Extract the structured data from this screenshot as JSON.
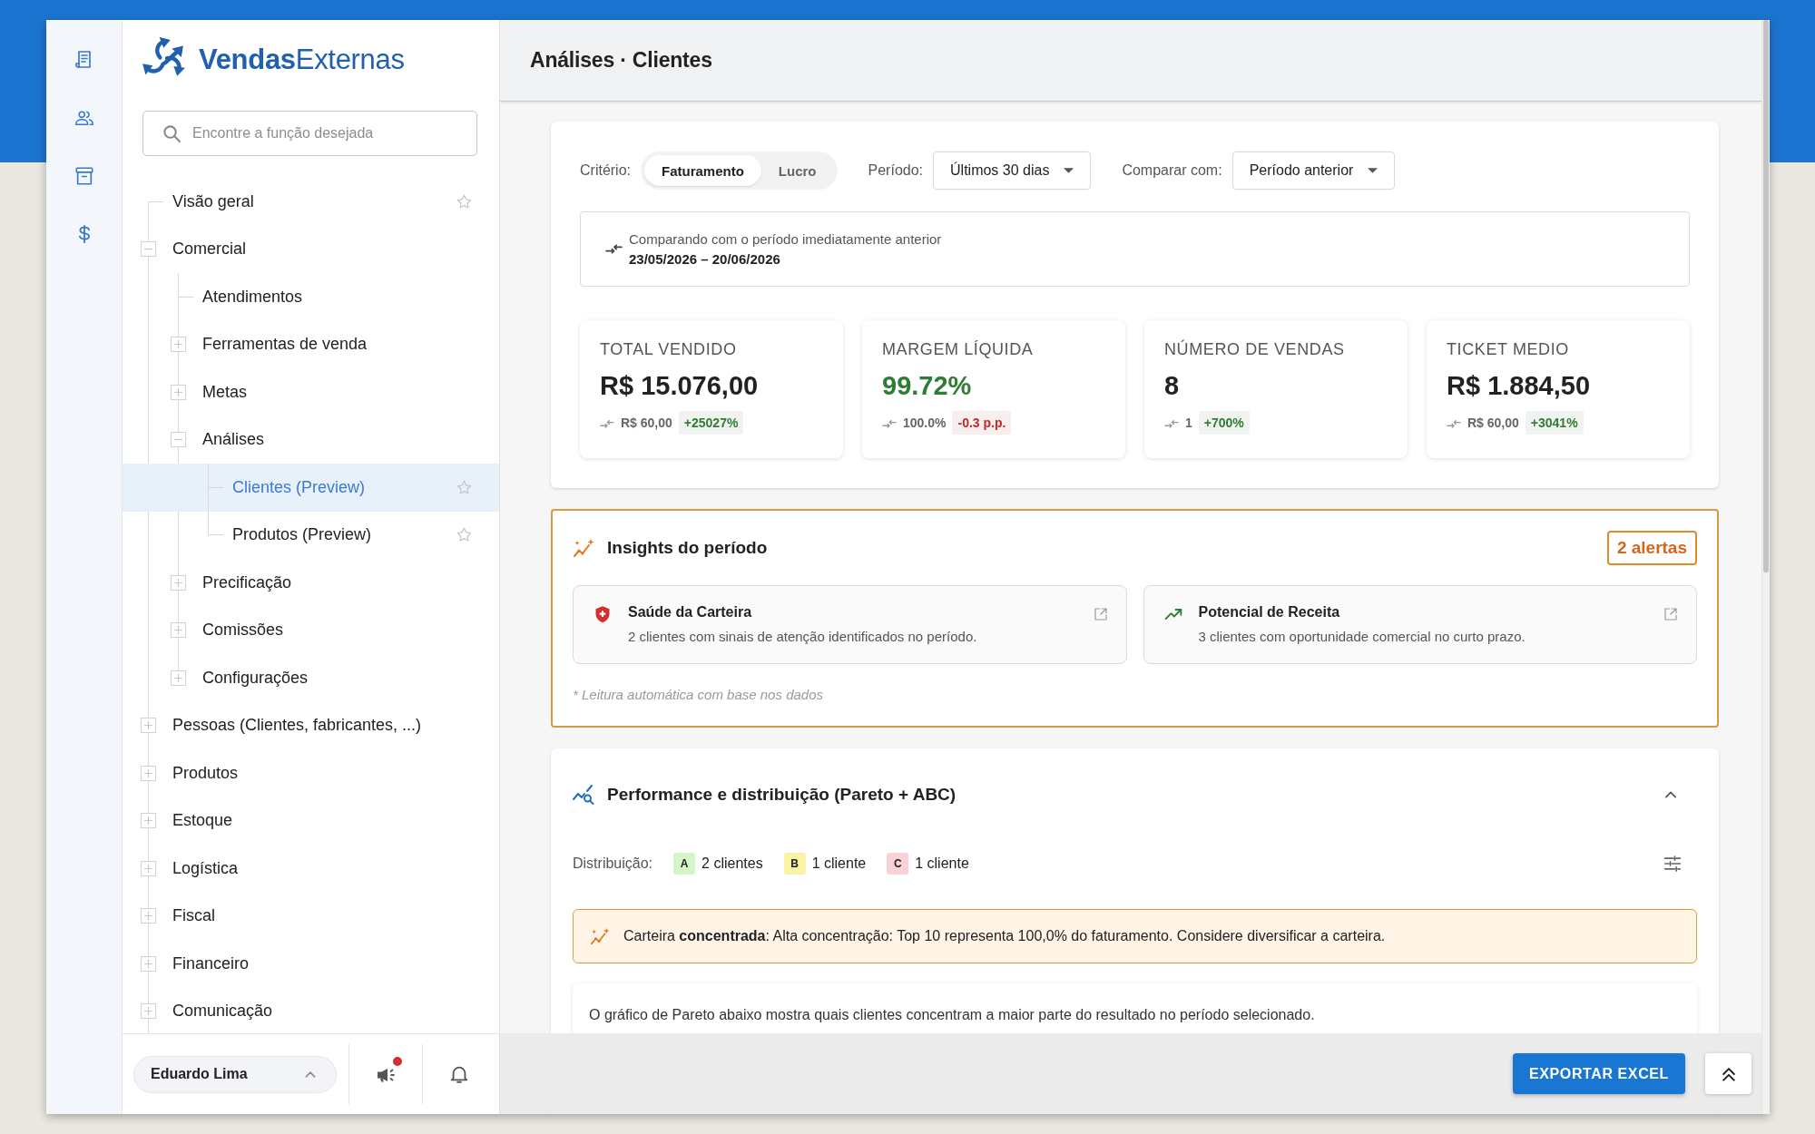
{
  "sidebar": {
    "logo": "**Vendas**Externas",
    "search": {
      "placeholder": "Encontre a função desejada"
    },
    "tree": [
      {
        "label": "Visão geral",
        "kind": "page",
        "selected": false,
        "favorite": false
      },
      {
        "label": "Comercial",
        "kind": "group",
        "expanded": true,
        "selected": false,
        "children": [
          {
            "label": "Atendimentos",
            "kind": "page",
            "selected": false
          },
          {
            "label": "Ferramentas de venda",
            "kind": "group",
            "expanded": false,
            "selected": false
          },
          {
            "label": "Metas",
            "kind": "group",
            "expanded": false,
            "selected": false
          },
          {
            "label": "Análises",
            "kind": "group",
            "expanded": true,
            "selected": false,
            "children": [
              {
                "label": "Clientes (Preview)",
                "kind": "page",
                "selected": true,
                "favorite": false
              },
              {
                "label": "Produtos (Preview)",
                "kind": "page",
                "selected": false,
                "favorite": false
              }
            ]
          },
          {
            "label": "Precificação",
            "kind": "group",
            "expanded": false,
            "selected": false
          },
          {
            "label": "Comissões",
            "kind": "group",
            "expanded": false,
            "selected": false
          },
          {
            "label": "Configurações",
            "kind": "group",
            "expanded": false,
            "selected": false
          }
        ]
      },
      {
        "label": "Pessoas (Clientes, fabricantes, ...)",
        "kind": "group",
        "expanded": false,
        "selected": false
      },
      {
        "label": "Produtos",
        "kind": "group",
        "expanded": false,
        "selected": false
      },
      {
        "label": "Estoque",
        "kind": "group",
        "expanded": false,
        "selected": false
      },
      {
        "label": "Logística",
        "kind": "group",
        "expanded": false,
        "selected": false
      },
      {
        "label": "Fiscal",
        "kind": "group",
        "expanded": false,
        "selected": false
      },
      {
        "label": "Financeiro",
        "kind": "group",
        "expanded": false,
        "selected": false
      },
      {
        "label": "Comunicação",
        "kind": "group",
        "expanded": false,
        "selected": false
      }
    ],
    "footer": {
      "user": "Eduardo Lima",
      "announcements_unread": true
    }
  },
  "header": {
    "title": "Análises · Clientes"
  },
  "filters": {
    "criterion": {
      "label": "Critério:",
      "options": [
        {
          "label": "Faturamento",
          "selected": true
        },
        {
          "label": "Lucro",
          "selected": false
        }
      ]
    },
    "period": {
      "label": "Período:",
      "value": "Últimos 30 dias"
    },
    "compare": {
      "label": "Comparar com:",
      "value": "Período anterior"
    },
    "comparison_note": {
      "text": "Comparando com o período imediatamente anterior",
      "range": "23/05/2026 – 20/06/2026"
    }
  },
  "kpis": [
    {
      "label": "TOTAL VENDIDO",
      "value": "R$ 15.076,00",
      "value_highlight": false,
      "previous": "R$ 60,00",
      "delta": "+25027%",
      "delta_positive": true
    },
    {
      "label": "MARGEM LÍQUIDA",
      "value": "99.72%",
      "value_highlight": true,
      "previous": "100.0%",
      "delta": "-0.3 p.p.",
      "delta_positive": false
    },
    {
      "label": "NÚMERO DE VENDAS",
      "value": "8",
      "value_highlight": false,
      "previous": "1",
      "delta": "+700%",
      "delta_positive": true
    },
    {
      "label": "TICKET MEDIO",
      "value": "R$ 1.884,50",
      "value_highlight": false,
      "previous": "R$ 60,00",
      "delta": "+3041%",
      "delta_positive": true
    }
  ],
  "insights": {
    "title": "Insights do período",
    "badge": "2 alertas",
    "cards": [
      {
        "kind": "risk",
        "title": "Saúde da Carteira",
        "text": "2 clientes com sinais de atenção identificados no período."
      },
      {
        "kind": "opportunity",
        "title": "Potencial de Receita",
        "text": "3 clientes com oportunidade comercial no curto prazo."
      }
    ],
    "footnote": "* Leitura automática com base nos dados"
  },
  "performance": {
    "title": "Performance e distribuição (Pareto + ABC)",
    "expanded": true,
    "distribution": {
      "label": "Distribuição:",
      "classes": [
        {
          "letter": "A",
          "text": "2 clientes",
          "color": "#d6f5c6"
        },
        {
          "letter": "B",
          "text": "1 cliente",
          "color": "#fbf3a4"
        },
        {
          "letter": "C",
          "text": "1 cliente",
          "color": "#fad2d5"
        }
      ]
    },
    "alert": "Carteira **concentrada**: Alta concentração: Top 10 representa 100,0% do faturamento. Considere diversificar a carteira.",
    "description": "O gráfico de Pareto abaixo mostra quais clientes concentram a maior parte do resultado no período selecionado."
  },
  "actions": {
    "export": "EXPORTAR EXCEL"
  }
}
